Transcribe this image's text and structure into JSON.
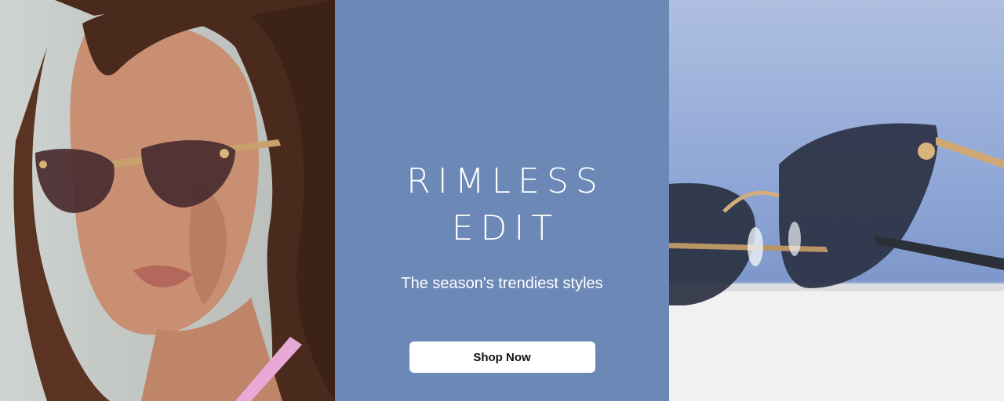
{
  "hero": {
    "left_image": {
      "icon": "model-wearing-sunglasses-photo"
    },
    "title_line1": "RIMLESS",
    "title_line2": "EDIT",
    "subtitle": "The season's trendiest styles",
    "cta_label": "Shop Now",
    "right_image": {
      "icon": "rimless-sunglasses-product-photo"
    }
  },
  "colors": {
    "panel_bg": "#6b88b6",
    "button_bg": "#ffffff",
    "button_text": "#111111",
    "text": "#ffffff"
  }
}
